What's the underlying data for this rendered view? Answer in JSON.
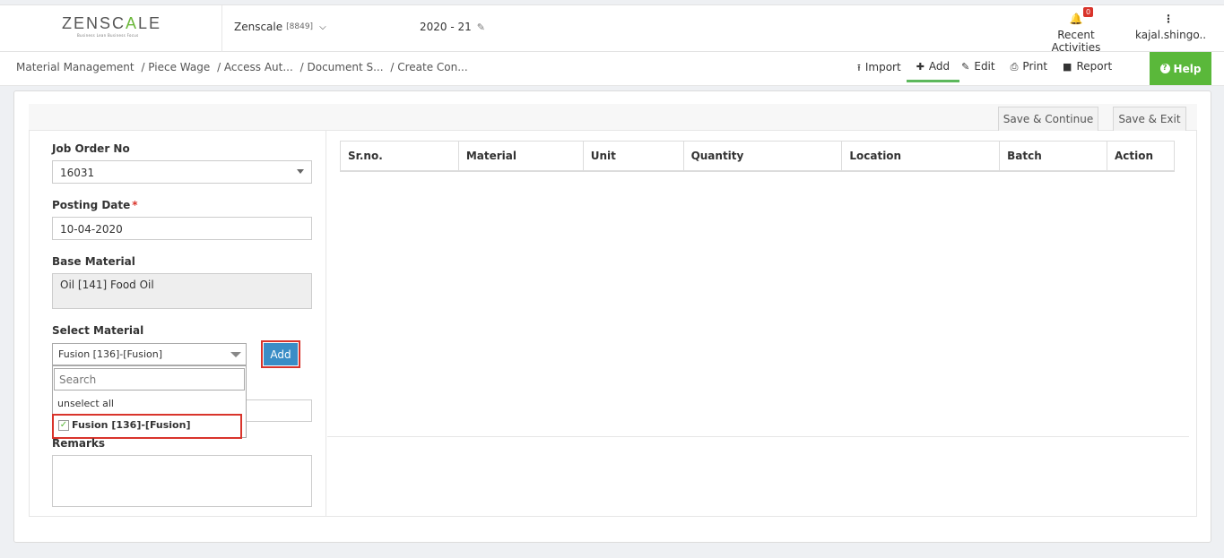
{
  "header": {
    "logo": {
      "prefix": "ZENSC",
      "accent": "A",
      "suffix": "LE",
      "tagline": "Business Lean Business Focus"
    },
    "company": {
      "name": "Zenscale",
      "code": "[8849]"
    },
    "year": "2020 - 21",
    "recent_activities": {
      "label": "Recent Activities",
      "badge": "0"
    },
    "user": {
      "label": "kajal.shingo.."
    }
  },
  "breadcrumb": [
    "Material Management",
    "/ Piece Wage",
    "/ Access Aut...",
    "/ Document S...",
    "/ Create Con..."
  ],
  "toolbar": {
    "import": "Import",
    "add": "Add",
    "edit": "Edit",
    "print": "Print",
    "report": "Report",
    "help": "Help"
  },
  "actions": {
    "save_continue": "Save & Continue",
    "save_exit": "Save & Exit"
  },
  "form": {
    "job_order": {
      "label": "Job Order No",
      "value": "16031"
    },
    "posting_date": {
      "label": "Posting Date",
      "required": "*",
      "value": "10-04-2020"
    },
    "base_material": {
      "label": "Base Material",
      "value": "Oil [141] Food Oil"
    },
    "select_material": {
      "label": "Select Material",
      "value": "Fusion [136]-[Fusion]",
      "add_label": "Add"
    },
    "dropdown": {
      "search_placeholder": "Search",
      "unselect_all": "unselect all",
      "option": "Fusion [136]-[Fusion]"
    },
    "remarks": {
      "label": "Remarks"
    }
  },
  "table": {
    "columns": [
      "Sr.no.",
      "Material",
      "Unit",
      "Quantity",
      "Location",
      "Batch",
      "Action"
    ]
  },
  "colors": {
    "accent_green": "#5ab83a",
    "highlight_red": "#d9342b",
    "button_blue": "#3a8dc6"
  }
}
